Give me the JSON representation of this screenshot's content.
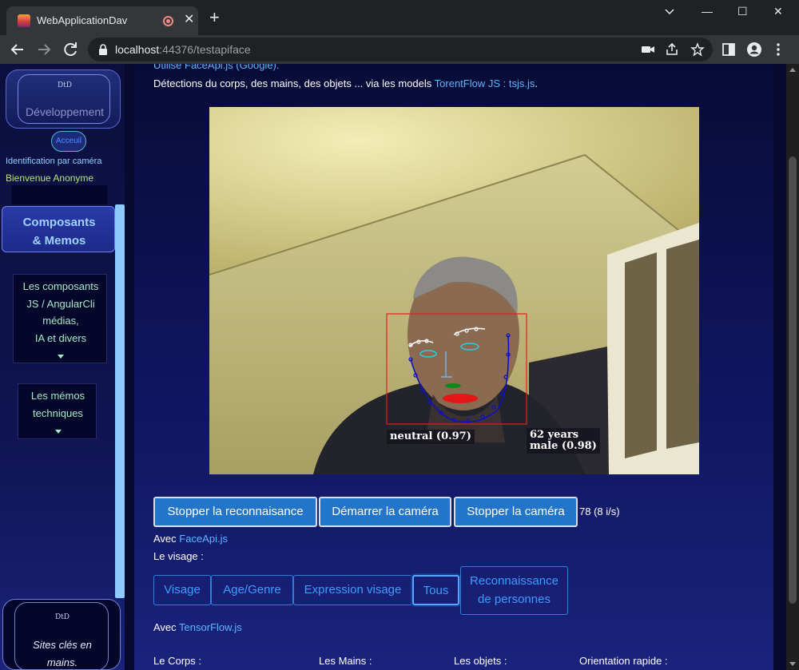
{
  "browser": {
    "tab_title": "WebApplicationDav",
    "url_host": "localhost",
    "url_rest": ":44376/testapiface",
    "new_tab": "+",
    "tab_close": "✕",
    "win_min": "—",
    "win_max": "☐",
    "win_close": "✕"
  },
  "sidebar": {
    "logo_mark": "DtD",
    "logo_label": "Développement",
    "home_label": "Acceuil",
    "ident_text": "Identification par caméra",
    "welcome_text": "Bienvenue Anonyme",
    "components_line1": "Composants",
    "components_line2": "& Memos",
    "menu_line1": "Les composants",
    "menu_line2": "JS / AngularCli",
    "menu_line3": "médias,",
    "menu_line4": "IA et divers",
    "memo_line1": "Les mémos",
    "memo_line2": "techniques",
    "sites_mark": "DtD",
    "sites_line1": "Sites clés en",
    "sites_line2": "mains."
  },
  "main": {
    "line1_link": "Utilise FaceApi.js (Google).",
    "line2_text": "Détections du corps, des mains, des objets ... via les models ",
    "line2_link": "TorentFlow JS : tsjs.js",
    "line2_end": ".",
    "face_expression": "neutral (0.97)",
    "face_age": "62 years",
    "face_gender": "male (0.98)",
    "btn_stop_recog": "Stopper la reconnaisance",
    "btn_start_cam": "Démarrer la caméra",
    "btn_stop_cam": "Stopper la caméra",
    "fps_text": "78 (8 i/s)",
    "avec1": "Avec ",
    "avec1_link": "FaceApi.js",
    "visage_label": "Le visage :",
    "opt_visage": "Visage",
    "opt_age": "Age/Genre",
    "opt_expr": "Expression visage",
    "opt_tous": "Tous",
    "opt_reco_line1": "Reconnaissance",
    "opt_reco_line2": "de personnes",
    "avec2": "Avec ",
    "avec2_link": "TensorFlow.js",
    "sec_corps": "Le Corps :",
    "sec_mains": "Les Mains :",
    "sec_objets": "Les objets :",
    "sec_orient": "Orientation rapide :"
  },
  "colors": {
    "accent_button": "#2275c8",
    "link": "#5fb6ff",
    "detection_box": "#e02020",
    "jaw_line": "#1010c0"
  }
}
